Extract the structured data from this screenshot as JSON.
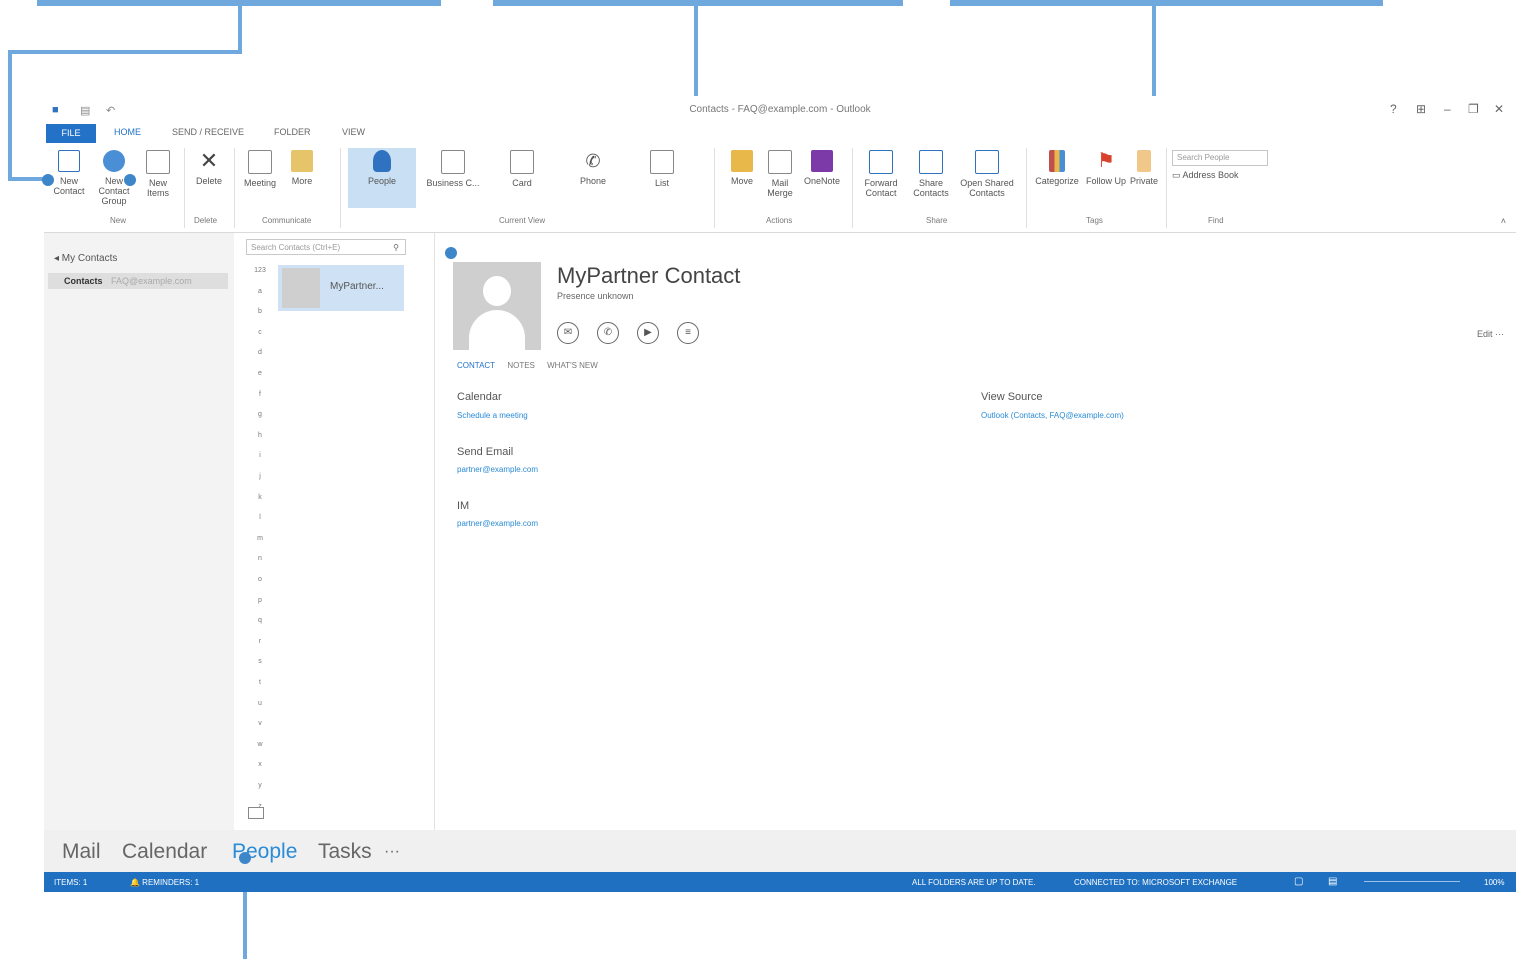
{
  "window": {
    "title": "Contacts - FAQ@example.com - Outlook",
    "controls": [
      "?",
      "⊞",
      "–",
      "❐",
      "✕"
    ]
  },
  "ribbon_tabs": [
    {
      "label": "FILE"
    },
    {
      "label": "HOME"
    },
    {
      "label": "SEND / RECEIVE"
    },
    {
      "label": "FOLDER"
    },
    {
      "label": "VIEW"
    }
  ],
  "ribbon": {
    "buttons": [
      {
        "label": "New Contact",
        "icon": "contact-card-icon"
      },
      {
        "label": "New Contact Group",
        "icon": "people-group-icon"
      },
      {
        "label": "New Items",
        "icon": "new-items-icon"
      },
      {
        "label": "Delete",
        "icon": "delete-icon"
      },
      {
        "label": "Meeting",
        "icon": "meeting-icon"
      },
      {
        "label": "More",
        "icon": "more-icon"
      },
      {
        "label": "People",
        "icon": "person-icon"
      },
      {
        "label": "Business C...",
        "icon": "business-card-icon"
      },
      {
        "label": "Card",
        "icon": "card-icon"
      },
      {
        "label": "Phone",
        "icon": "phone-icon"
      },
      {
        "label": "List",
        "icon": "list-icon"
      },
      {
        "label": "Move",
        "icon": "move-folder-icon"
      },
      {
        "label": "Mail Merge",
        "icon": "mail-merge-icon"
      },
      {
        "label": "OneNote",
        "icon": "onenote-icon"
      },
      {
        "label": "Forward Contact",
        "icon": "forward-contact-icon"
      },
      {
        "label": "Share Contacts",
        "icon": "share-contacts-icon"
      },
      {
        "label": "Open Shared Contacts",
        "icon": "open-shared-icon"
      },
      {
        "label": "Categorize",
        "icon": "categorize-icon"
      },
      {
        "label": "Follow Up",
        "icon": "flag-icon"
      },
      {
        "label": "Private",
        "icon": "lock-icon"
      }
    ],
    "groups": [
      "New",
      "Delete",
      "Communicate",
      "Current View",
      "Actions",
      "Share",
      "Tags",
      "Find"
    ],
    "search_placeholder": "Search People",
    "address_book": "Address Book"
  },
  "folders": {
    "header": "◂ My Contacts",
    "selected": "Contacts",
    "selected_account": "FAQ@example.com"
  },
  "contact_list": {
    "search_placeholder": "Search Contacts (Ctrl+E)",
    "alphabet": [
      "123",
      "a",
      "b",
      "c",
      "d",
      "e",
      "f",
      "g",
      "h",
      "i",
      "j",
      "k",
      "l",
      "m",
      "n",
      "o",
      "p",
      "q",
      "r",
      "s",
      "t",
      "u",
      "v",
      "w",
      "x",
      "y",
      "z"
    ],
    "cards": [
      {
        "name": "MyPartner..."
      }
    ]
  },
  "contact": {
    "name": "MyPartner Contact",
    "status": "Presence unknown",
    "action_icons": [
      "message-icon",
      "call-icon",
      "video-icon",
      "email-icon"
    ],
    "edit": "Edit ···",
    "tabs": [
      "CONTACT",
      "NOTES",
      "WHAT'S NEW"
    ],
    "calendar_label": "Calendar",
    "calendar_value": "Schedule a meeting",
    "email_label": "Send Email",
    "email_value": "partner@example.com",
    "im_label": "IM",
    "im_value": "partner@example.com",
    "source_label": "View Source",
    "source_value": "Outlook (Contacts, FAQ@example.com)"
  },
  "nav": {
    "mail": "Mail",
    "calendar": "Calendar",
    "people": "People",
    "tasks": "Tasks",
    "more": "···"
  },
  "status": {
    "items": "ITEMS: 1",
    "reminders": "🔔 REMINDERS: 1",
    "sync": "ALL FOLDERS ARE UP TO DATE.",
    "connection": "CONNECTED TO: MICROSOFT EXCHANGE",
    "zoom": "100%"
  },
  "colors": {
    "accent": "#2372c8",
    "callout": "#6fa8dc",
    "status_bar": "#1f70c1"
  }
}
